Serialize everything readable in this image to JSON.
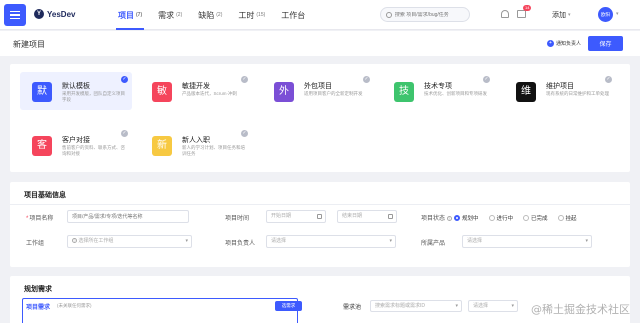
{
  "header": {
    "logo_mark": "Y",
    "logo_text": "YesDev",
    "nav": [
      {
        "label": "项目",
        "count": "(7)",
        "active": true
      },
      {
        "label": "需求",
        "count": "(2)"
      },
      {
        "label": "缺陷",
        "count": "(2)"
      },
      {
        "label": "工时",
        "count": "(15)"
      },
      {
        "label": "工作台",
        "count": ""
      }
    ],
    "search_placeholder": "搜索 项目/需求/bug/任务",
    "message_badge": "14",
    "add_label": "添加",
    "avatar_text": "欧阳"
  },
  "subbar": {
    "title": "新建项目",
    "notify_label": "通知负责人",
    "save_label": "保存"
  },
  "templates": [
    {
      "icon": "默",
      "name": "默认模板",
      "desc": "采用开发模版，团队自定义项目字段",
      "color": "#3d5afe",
      "selected": true
    },
    {
      "icon": "敏",
      "name": "敏捷开发",
      "desc": "产品版本迭代，Scrum·冲刺",
      "color": "#f5455c",
      "selected": false
    },
    {
      "icon": "外",
      "name": "外包项目",
      "desc": "适用项目客户的全新定制开发",
      "color": "#7b4fd6",
      "selected": false
    },
    {
      "icon": "技",
      "name": "技术专项",
      "desc": "技术优化、创新项目和专项研发",
      "color": "#3ec46d",
      "selected": false
    },
    {
      "icon": "维",
      "name": "维护项目",
      "desc": "现有系统的日常维护和工单处理",
      "color": "#111111",
      "selected": false
    },
    {
      "icon": "客",
      "name": "客户对接",
      "desc": "售前客户的资料、联系方式、咨询和对接",
      "color": "#f5455c",
      "selected": false
    },
    {
      "icon": "新",
      "name": "新人入职",
      "desc": "新人的学习计划、项目任务和培训任务",
      "color": "#f7c942",
      "selected": false
    }
  ],
  "info": {
    "title": "项目基础信息",
    "name_label": "项目名称",
    "name_placeholder": "项目/产品/需求/专项/迭代等名称",
    "time_label": "项目时间",
    "start_placeholder": "开始日期",
    "end_placeholder": "结束日期",
    "status_label": "项目状态",
    "status_options": [
      "规划中",
      "进行中",
      "已完成",
      "挂起"
    ],
    "group_label": "工作组",
    "group_placeholder": "选择所在工作组",
    "owner_label": "项目负责人",
    "owner_placeholder": "请选择",
    "product_label": "所属产品",
    "product_placeholder": "请选择"
  },
  "plan": {
    "title": "规划需求",
    "panel_title": "项目需求",
    "panel_sub": "(未关联任何需求)",
    "select_label": "选需求",
    "pool_label": "需求池",
    "pool_placeholder": "搜索需求标题或需求ID",
    "pool_select_placeholder": "请选择"
  },
  "watermark": "@稀土掘金技术社区"
}
